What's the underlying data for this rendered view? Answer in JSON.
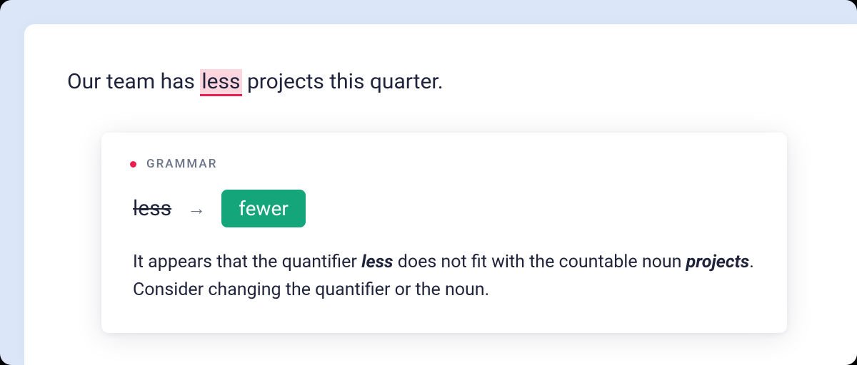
{
  "sentence": {
    "before": "Our team has ",
    "highlighted": "less",
    "after": " projects this quarter."
  },
  "card": {
    "category": "GRAMMAR",
    "original": "less",
    "arrow": "→",
    "replacement": "fewer",
    "explanation": {
      "part1": "It appears that the quantifier ",
      "term1": "less",
      "part2": " does not fit with the countable noun ",
      "term2": "projects",
      "part3": ". Consider changing the quantifier or the noun."
    }
  }
}
